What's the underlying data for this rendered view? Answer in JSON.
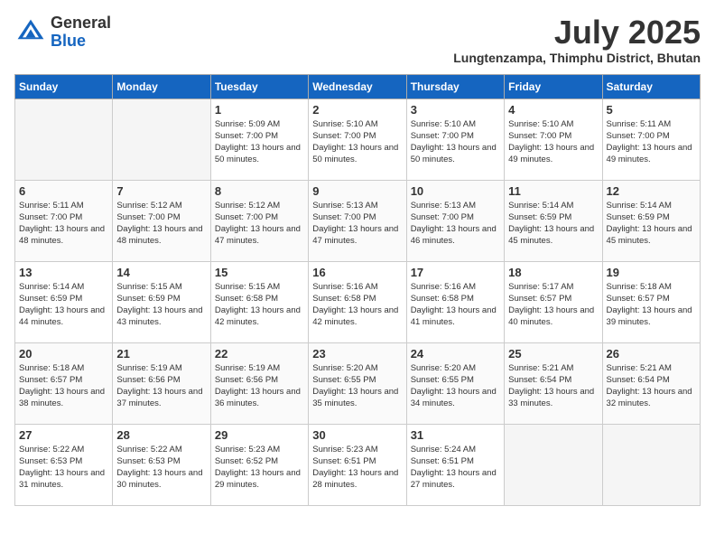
{
  "header": {
    "logo_general": "General",
    "logo_blue": "Blue",
    "month_year": "July 2025",
    "location": "Lungtenzampa, Thimphu District, Bhutan"
  },
  "days_of_week": [
    "Sunday",
    "Monday",
    "Tuesday",
    "Wednesday",
    "Thursday",
    "Friday",
    "Saturday"
  ],
  "weeks": [
    [
      {
        "day": "",
        "sunrise": "",
        "sunset": "",
        "daylight": ""
      },
      {
        "day": "",
        "sunrise": "",
        "sunset": "",
        "daylight": ""
      },
      {
        "day": "1",
        "sunrise": "Sunrise: 5:09 AM",
        "sunset": "Sunset: 7:00 PM",
        "daylight": "Daylight: 13 hours and 50 minutes."
      },
      {
        "day": "2",
        "sunrise": "Sunrise: 5:10 AM",
        "sunset": "Sunset: 7:00 PM",
        "daylight": "Daylight: 13 hours and 50 minutes."
      },
      {
        "day": "3",
        "sunrise": "Sunrise: 5:10 AM",
        "sunset": "Sunset: 7:00 PM",
        "daylight": "Daylight: 13 hours and 50 minutes."
      },
      {
        "day": "4",
        "sunrise": "Sunrise: 5:10 AM",
        "sunset": "Sunset: 7:00 PM",
        "daylight": "Daylight: 13 hours and 49 minutes."
      },
      {
        "day": "5",
        "sunrise": "Sunrise: 5:11 AM",
        "sunset": "Sunset: 7:00 PM",
        "daylight": "Daylight: 13 hours and 49 minutes."
      }
    ],
    [
      {
        "day": "6",
        "sunrise": "Sunrise: 5:11 AM",
        "sunset": "Sunset: 7:00 PM",
        "daylight": "Daylight: 13 hours and 48 minutes."
      },
      {
        "day": "7",
        "sunrise": "Sunrise: 5:12 AM",
        "sunset": "Sunset: 7:00 PM",
        "daylight": "Daylight: 13 hours and 48 minutes."
      },
      {
        "day": "8",
        "sunrise": "Sunrise: 5:12 AM",
        "sunset": "Sunset: 7:00 PM",
        "daylight": "Daylight: 13 hours and 47 minutes."
      },
      {
        "day": "9",
        "sunrise": "Sunrise: 5:13 AM",
        "sunset": "Sunset: 7:00 PM",
        "daylight": "Daylight: 13 hours and 47 minutes."
      },
      {
        "day": "10",
        "sunrise": "Sunrise: 5:13 AM",
        "sunset": "Sunset: 7:00 PM",
        "daylight": "Daylight: 13 hours and 46 minutes."
      },
      {
        "day": "11",
        "sunrise": "Sunrise: 5:14 AM",
        "sunset": "Sunset: 6:59 PM",
        "daylight": "Daylight: 13 hours and 45 minutes."
      },
      {
        "day": "12",
        "sunrise": "Sunrise: 5:14 AM",
        "sunset": "Sunset: 6:59 PM",
        "daylight": "Daylight: 13 hours and 45 minutes."
      }
    ],
    [
      {
        "day": "13",
        "sunrise": "Sunrise: 5:14 AM",
        "sunset": "Sunset: 6:59 PM",
        "daylight": "Daylight: 13 hours and 44 minutes."
      },
      {
        "day": "14",
        "sunrise": "Sunrise: 5:15 AM",
        "sunset": "Sunset: 6:59 PM",
        "daylight": "Daylight: 13 hours and 43 minutes."
      },
      {
        "day": "15",
        "sunrise": "Sunrise: 5:15 AM",
        "sunset": "Sunset: 6:58 PM",
        "daylight": "Daylight: 13 hours and 42 minutes."
      },
      {
        "day": "16",
        "sunrise": "Sunrise: 5:16 AM",
        "sunset": "Sunset: 6:58 PM",
        "daylight": "Daylight: 13 hours and 42 minutes."
      },
      {
        "day": "17",
        "sunrise": "Sunrise: 5:16 AM",
        "sunset": "Sunset: 6:58 PM",
        "daylight": "Daylight: 13 hours and 41 minutes."
      },
      {
        "day": "18",
        "sunrise": "Sunrise: 5:17 AM",
        "sunset": "Sunset: 6:57 PM",
        "daylight": "Daylight: 13 hours and 40 minutes."
      },
      {
        "day": "19",
        "sunrise": "Sunrise: 5:18 AM",
        "sunset": "Sunset: 6:57 PM",
        "daylight": "Daylight: 13 hours and 39 minutes."
      }
    ],
    [
      {
        "day": "20",
        "sunrise": "Sunrise: 5:18 AM",
        "sunset": "Sunset: 6:57 PM",
        "daylight": "Daylight: 13 hours and 38 minutes."
      },
      {
        "day": "21",
        "sunrise": "Sunrise: 5:19 AM",
        "sunset": "Sunset: 6:56 PM",
        "daylight": "Daylight: 13 hours and 37 minutes."
      },
      {
        "day": "22",
        "sunrise": "Sunrise: 5:19 AM",
        "sunset": "Sunset: 6:56 PM",
        "daylight": "Daylight: 13 hours and 36 minutes."
      },
      {
        "day": "23",
        "sunrise": "Sunrise: 5:20 AM",
        "sunset": "Sunset: 6:55 PM",
        "daylight": "Daylight: 13 hours and 35 minutes."
      },
      {
        "day": "24",
        "sunrise": "Sunrise: 5:20 AM",
        "sunset": "Sunset: 6:55 PM",
        "daylight": "Daylight: 13 hours and 34 minutes."
      },
      {
        "day": "25",
        "sunrise": "Sunrise: 5:21 AM",
        "sunset": "Sunset: 6:54 PM",
        "daylight": "Daylight: 13 hours and 33 minutes."
      },
      {
        "day": "26",
        "sunrise": "Sunrise: 5:21 AM",
        "sunset": "Sunset: 6:54 PM",
        "daylight": "Daylight: 13 hours and 32 minutes."
      }
    ],
    [
      {
        "day": "27",
        "sunrise": "Sunrise: 5:22 AM",
        "sunset": "Sunset: 6:53 PM",
        "daylight": "Daylight: 13 hours and 31 minutes."
      },
      {
        "day": "28",
        "sunrise": "Sunrise: 5:22 AM",
        "sunset": "Sunset: 6:53 PM",
        "daylight": "Daylight: 13 hours and 30 minutes."
      },
      {
        "day": "29",
        "sunrise": "Sunrise: 5:23 AM",
        "sunset": "Sunset: 6:52 PM",
        "daylight": "Daylight: 13 hours and 29 minutes."
      },
      {
        "day": "30",
        "sunrise": "Sunrise: 5:23 AM",
        "sunset": "Sunset: 6:51 PM",
        "daylight": "Daylight: 13 hours and 28 minutes."
      },
      {
        "day": "31",
        "sunrise": "Sunrise: 5:24 AM",
        "sunset": "Sunset: 6:51 PM",
        "daylight": "Daylight: 13 hours and 27 minutes."
      },
      {
        "day": "",
        "sunrise": "",
        "sunset": "",
        "daylight": ""
      },
      {
        "day": "",
        "sunrise": "",
        "sunset": "",
        "daylight": ""
      }
    ]
  ]
}
